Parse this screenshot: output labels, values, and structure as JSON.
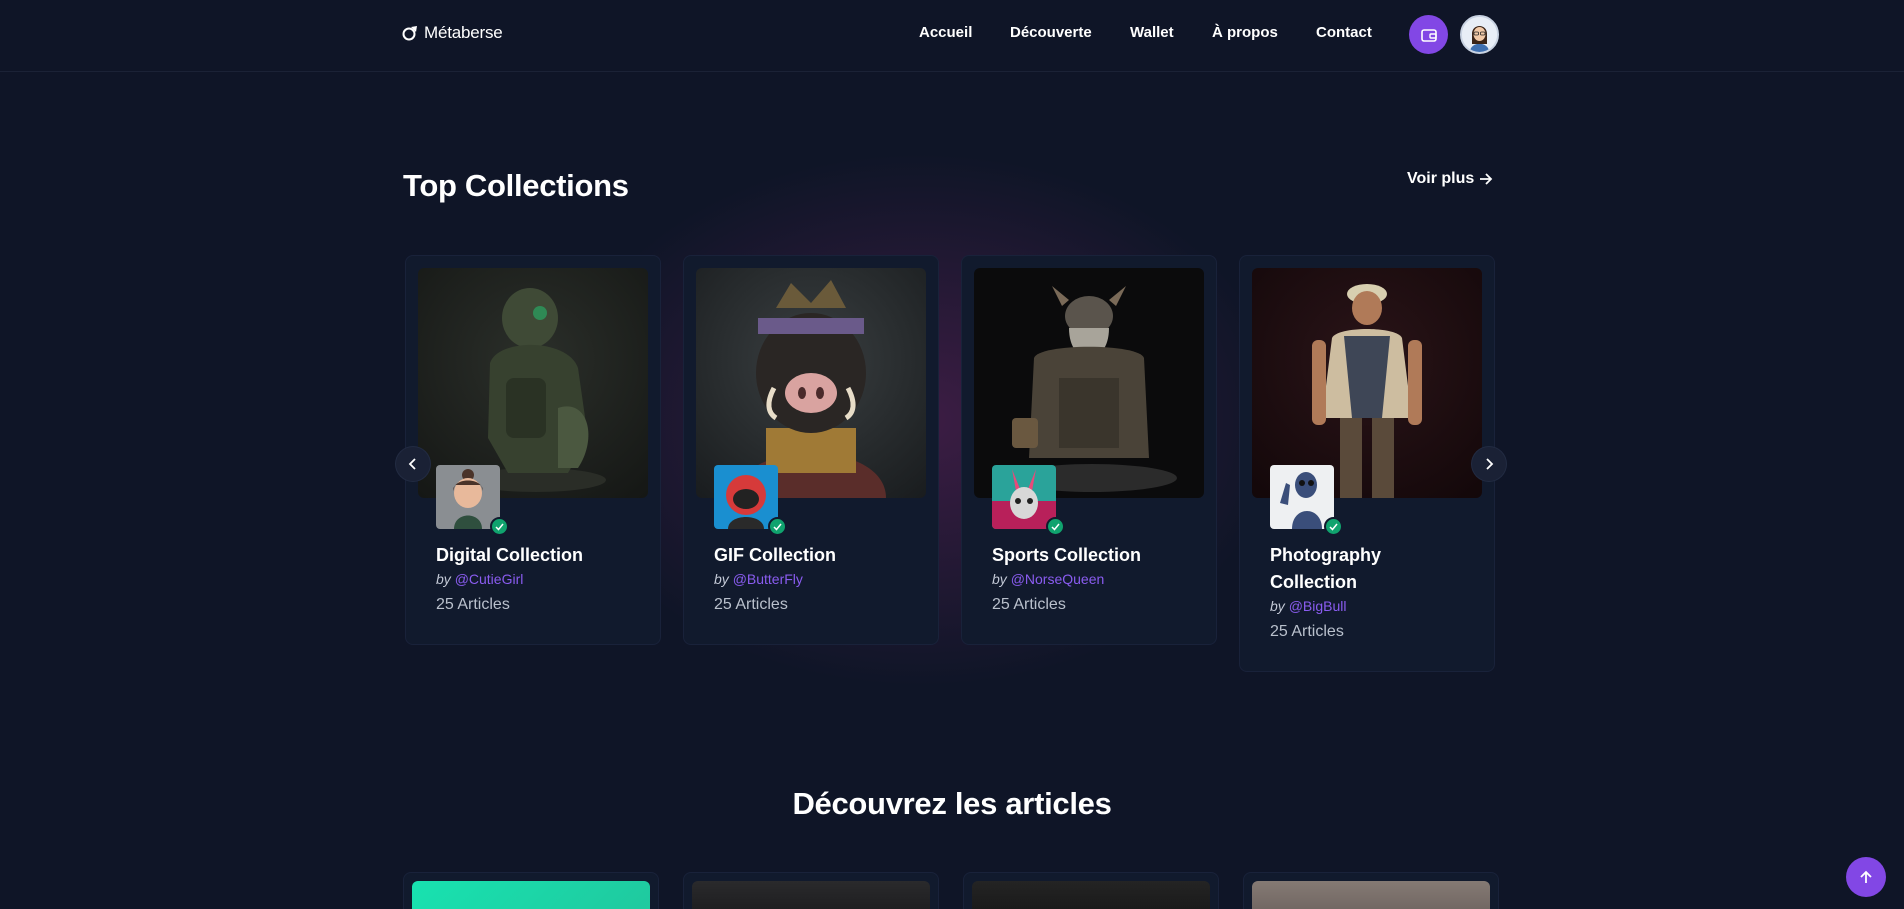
{
  "navbar": {
    "logo_text": "Métaberse",
    "links": [
      "Accueil",
      "Découverte",
      "Wallet",
      "À propos",
      "Contact"
    ]
  },
  "top_collections": {
    "title": "Top Collections",
    "see_more_label": "Voir plus",
    "cards": [
      {
        "title": "Digital Collection",
        "by_label": "by",
        "handle": "@CutieGirl",
        "count": "25 Articles"
      },
      {
        "title": "GIF Collection",
        "by_label": "by",
        "handle": "@ButterFly",
        "count": "25 Articles"
      },
      {
        "title": "Sports Collection",
        "by_label": "by",
        "handle": "@NorseQueen",
        "count": "25 Articles"
      },
      {
        "title": "Photography Collection",
        "by_label": "by",
        "handle": "@BigBull",
        "count": "25 Articles"
      }
    ]
  },
  "articles_section": {
    "title": "Découvrez les articles"
  },
  "colors": {
    "background": "#0f1527",
    "accent": "#8247e5",
    "verified": "#10a36e",
    "handle": "#8a5cf0"
  },
  "icons": {
    "logo": "rocket-icon",
    "wallet": "wallet-icon",
    "see_more": "arrow-right-icon",
    "prev": "chevron-left-icon",
    "next": "chevron-right-icon",
    "verified": "check-icon",
    "scroll_top": "arrow-up-icon"
  }
}
